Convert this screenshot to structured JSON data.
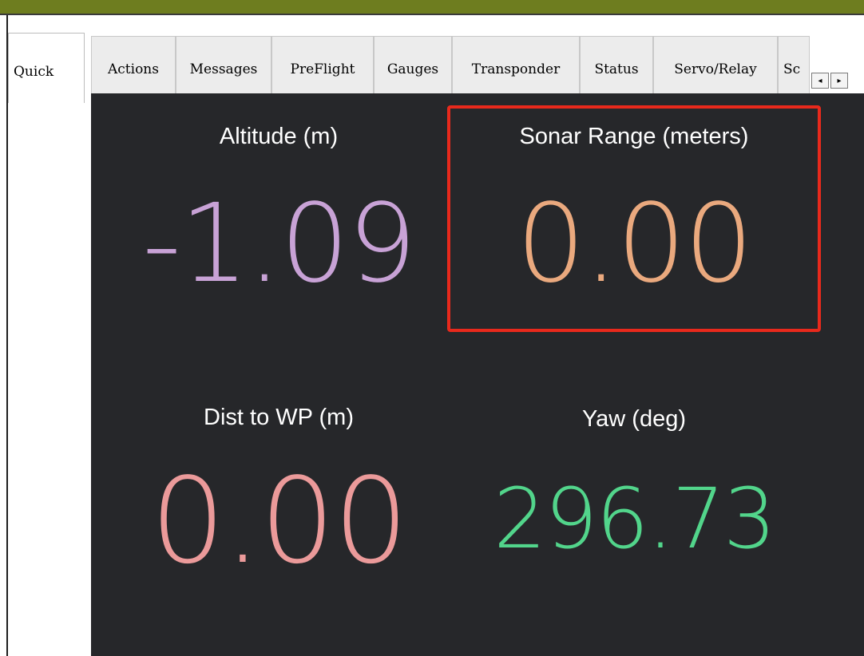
{
  "tabs": [
    {
      "label": "Quick",
      "active": true
    },
    {
      "label": "Actions"
    },
    {
      "label": "Messages"
    },
    {
      "label": "PreFlight"
    },
    {
      "label": "Gauges"
    },
    {
      "label": "Transponder"
    },
    {
      "label": "Status"
    },
    {
      "label": "Servo/Relay"
    },
    {
      "label": "Sc"
    }
  ],
  "tab_scroll": {
    "left_icon": "arrow-left-icon",
    "right_icon": "arrow-right-icon",
    "left_glyph": "◂",
    "right_glyph": "▸"
  },
  "quick": {
    "altitude": {
      "label": "Altitude (m)",
      "value": "-1.09",
      "color": "#c8a2d6"
    },
    "sonar_range": {
      "label": "Sonar Range (meters)",
      "value": "0.00",
      "color": "#eaa97e",
      "highlighted": true
    },
    "dist_to_wp": {
      "label": "Dist to WP (m)",
      "value": "0.00",
      "color": "#eb9a9a"
    },
    "yaw": {
      "label": "Yaw (deg)",
      "value": "296.73",
      "color": "#52d58b"
    }
  },
  "colors": {
    "title_bar": "#6e7d1f",
    "panel_bg": "#26272a",
    "highlight": "#e8291c"
  }
}
